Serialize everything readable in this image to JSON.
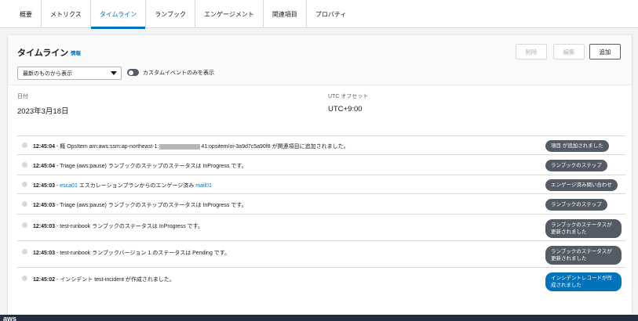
{
  "tabs": [
    {
      "label": "概要",
      "active": false
    },
    {
      "label": "メトリクス",
      "active": false
    },
    {
      "label": "タイムライン",
      "active": true
    },
    {
      "label": "ランブック",
      "active": false
    },
    {
      "label": "エンゲージメント",
      "active": false
    },
    {
      "label": "関連項目",
      "active": false
    },
    {
      "label": "プロパティ",
      "active": false
    }
  ],
  "header": {
    "title": "タイムライン",
    "info": "情報",
    "buttons": {
      "delete": "削除",
      "edit": "編集",
      "add": "追加"
    },
    "filter_value": "最新のものから表示",
    "toggle_label": "カスタムイベントのみを表示"
  },
  "meta": {
    "date_label": "日付",
    "date_value": "2023年3月18日",
    "tz_label": "UTC オフセット",
    "tz_value": "UTC+9:00"
  },
  "events": [
    {
      "time": "12:45:04",
      "pre": "- 概 OpsItem arn:aws:ssm:ap-northeast-1:",
      "post": "41:opsitem/oi-3a9d7c5a90f8 が関連項目に追加されました。",
      "badge": "項目 が追加されました"
    },
    {
      "time": "12:45:04",
      "text": "- Triage (aws:pause) ランブックのステップのステータスは InProgress です。",
      "badge": "ランブックのステップ"
    },
    {
      "time": "12:45:03",
      "link1": "esca01",
      "mid": " エスカレーションプランからのエンゲージ済み ",
      "link2": "mail01",
      "badge": "エンゲージ済み問い合わせ"
    },
    {
      "time": "12:45:03",
      "text": "- Triage (aws:pause) ランブックのステップのステータスは InProgress です。",
      "badge": "ランブックのステップ"
    },
    {
      "time": "12:45:03",
      "text": "- test-runbook ランブックのステータスは InProgress です。",
      "badge": "ランブックのステータスが更新されました"
    },
    {
      "time": "12:45:03",
      "text": "- test-runbook ランブックバージョン 1 のステータスは Pending です。",
      "badge": "ランブックのステータスが更新されました"
    },
    {
      "time": "12:45:02",
      "text": "- インシデント test-incident が作成されました。",
      "badge": "インシデントレコードが作成されました"
    }
  ],
  "footer": "aws",
  "colors": {
    "accent": "#0073bb",
    "badge_gray": "#545b64"
  }
}
